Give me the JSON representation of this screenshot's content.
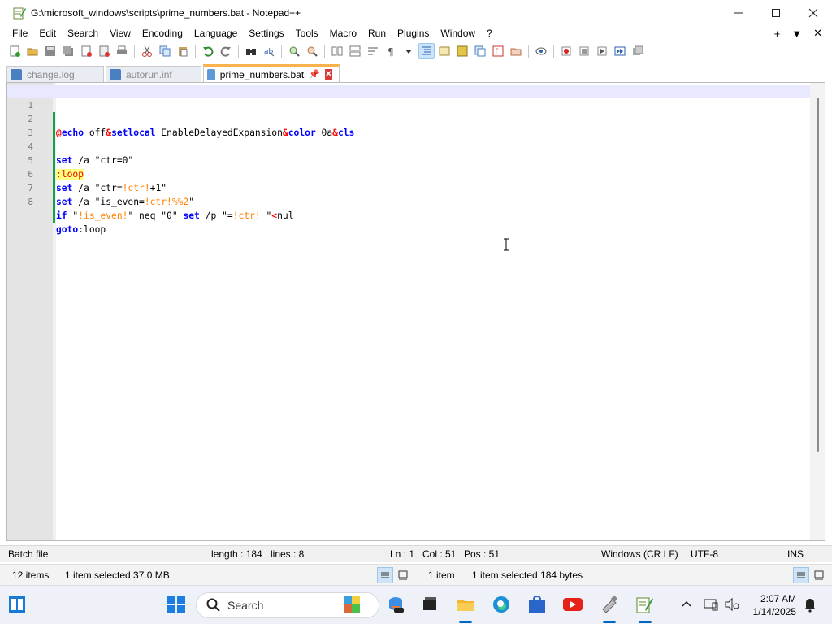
{
  "window": {
    "title": "G:\\microsoft_windows\\scripts\\prime_numbers.bat - Notepad++"
  },
  "menu": {
    "items": [
      "File",
      "Edit",
      "Search",
      "View",
      "Encoding",
      "Language",
      "Settings",
      "Tools",
      "Macro",
      "Run",
      "Plugins",
      "Window",
      "?"
    ],
    "right": [
      "+",
      "▼",
      "✕"
    ]
  },
  "tabs": [
    {
      "label": "change.log",
      "active": false
    },
    {
      "label": "autorun.inf",
      "active": false
    },
    {
      "label": "prime_numbers.bat",
      "active": true
    }
  ],
  "editor": {
    "lines": [
      {
        "n": "1",
        "text": "@echo off&setlocal EnableDelayedExpansion&color 0a&cls"
      },
      {
        "n": "2",
        "text": ""
      },
      {
        "n": "3",
        "text": "set /a \"ctr=0\""
      },
      {
        "n": "4",
        "text": ":loop"
      },
      {
        "n": "5",
        "text": "set /a \"ctr=!ctr!+1\""
      },
      {
        "n": "6",
        "text": "set /a \"is_even=!ctr!%%2\""
      },
      {
        "n": "7",
        "text": "if \"!is_even!\" neq \"0\" set /p \"=!ctr! \"<nul"
      },
      {
        "n": "8",
        "text": "goto:loop"
      }
    ]
  },
  "status": {
    "file_type": "Batch file",
    "length": "length : 184",
    "lines": "lines : 8",
    "ln": "Ln : 1",
    "col": "Col : 51",
    "pos": "Pos : 51",
    "eol": "Windows (CR LF)",
    "encoding": "UTF-8",
    "mode": "INS"
  },
  "explorer_status": {
    "left_items": "12 items",
    "left_selected": "1 item selected  37.0 MB",
    "right_items": "1 item",
    "right_selected": "1 item selected  184 bytes"
  },
  "taskbar": {
    "search_placeholder": "Search",
    "time": "2:07 AM",
    "date": "1/14/2025"
  },
  "colors": {
    "keyword": "#0000ff",
    "operator": "#ff0000",
    "variable": "#ff8000",
    "active_tab_accent": "#fab24c",
    "change_marker": "#19a04a"
  }
}
